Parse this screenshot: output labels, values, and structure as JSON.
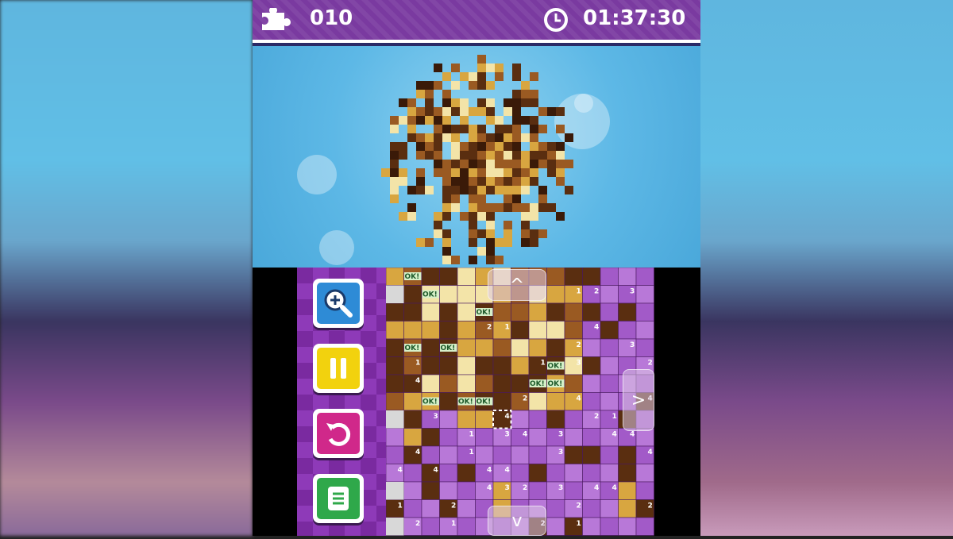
{
  "header": {
    "puzzle_count": "010",
    "timer": "01:37:30"
  },
  "icons": {
    "puzzle": "puzzle-piece-icon",
    "clock": "clock-icon",
    "zoom": "magnifier-plus-icon",
    "pause": "pause-icon",
    "undo": "undo-icon",
    "menu": "menu-list-icon"
  },
  "colors": {
    "topbar": "#7a3aa0",
    "sky": "#5db8e6",
    "zoom_button": "#2e8bd6",
    "pause_button": "#f2d20e",
    "undo_button": "#d0288a",
    "menu_button": "#2fa84a",
    "grid_purple": "#a25ac8",
    "brown_dark": "#5a2e10",
    "brown_mid": "#9a5a22",
    "gold": "#d8a640",
    "cream": "#f3e4a8"
  },
  "grid_labels": [
    "OK!",
    "1",
    "2",
    "3",
    "4"
  ],
  "nav": {
    "up": "^",
    "down": "v",
    "right": ">"
  }
}
